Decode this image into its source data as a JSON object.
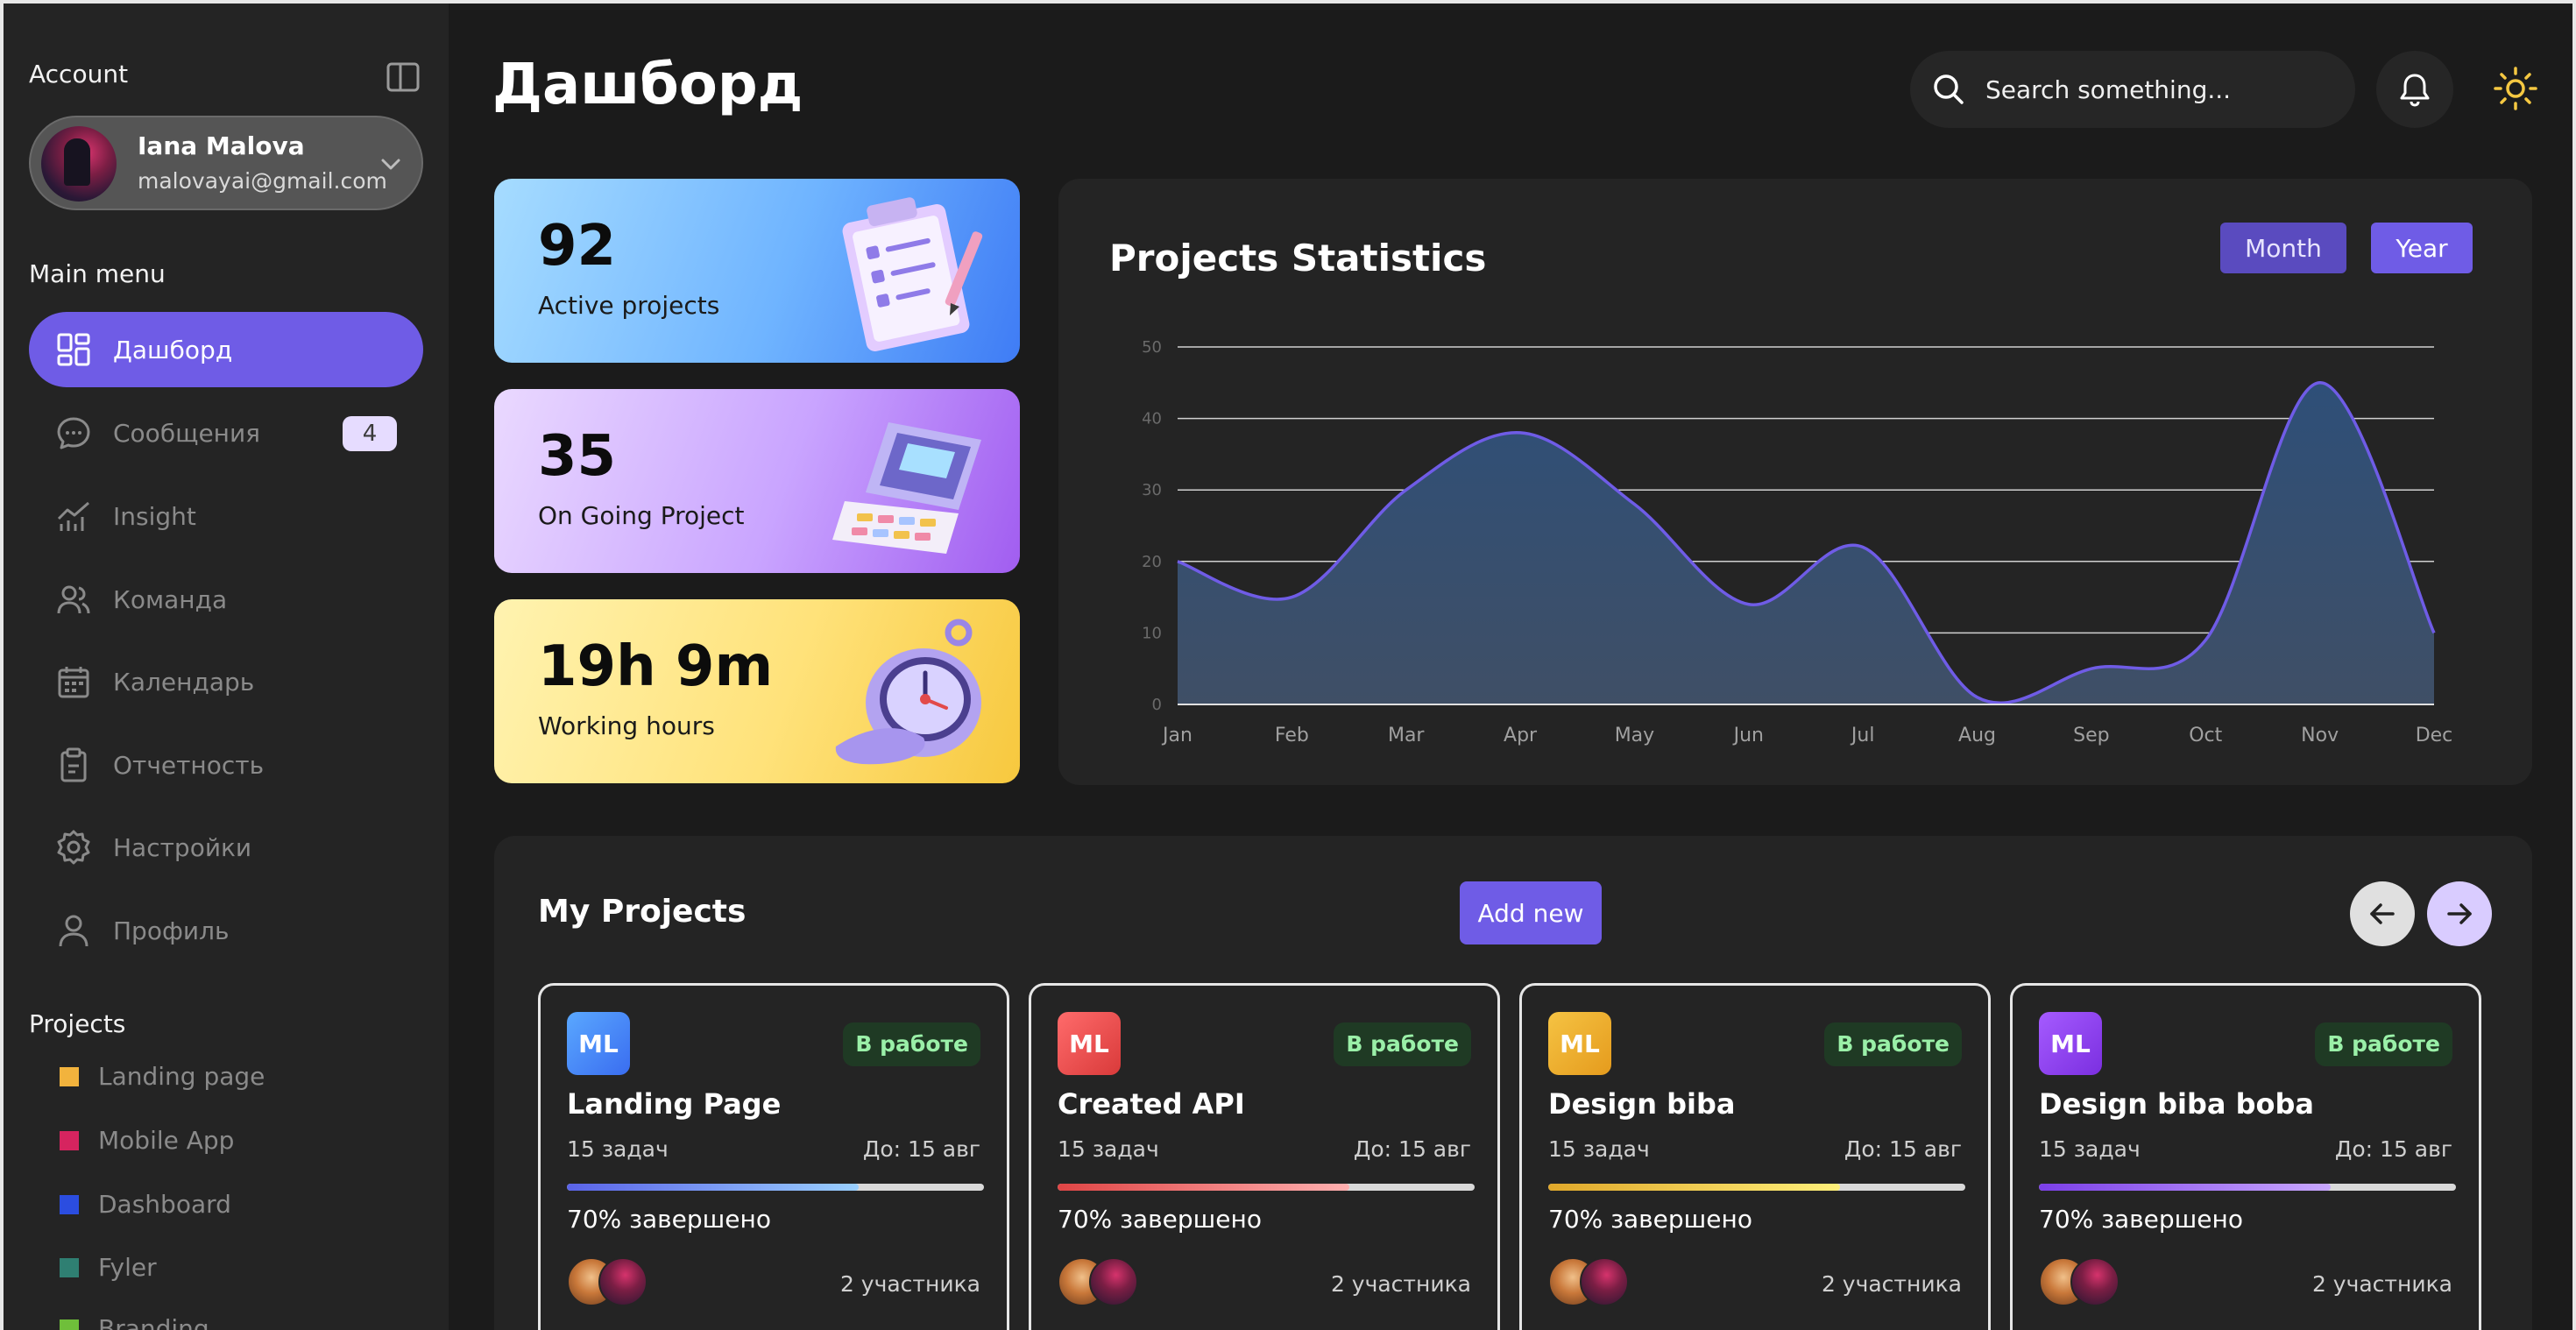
{
  "sidebar": {
    "account_heading": "Account",
    "user": {
      "name": "Iana Malova",
      "email": "malovayai@gmail.com"
    },
    "main_menu_heading": "Main menu",
    "menu": [
      {
        "label": "Дашборд",
        "icon": "dashboard-icon",
        "active": true
      },
      {
        "label": "Сообщения",
        "icon": "chat-icon",
        "badge": "4"
      },
      {
        "label": "Insight",
        "icon": "chart-line-icon"
      },
      {
        "label": "Команда",
        "icon": "users-icon"
      },
      {
        "label": "Календарь",
        "icon": "calendar-icon"
      },
      {
        "label": "Отчетность",
        "icon": "clipboard-icon"
      },
      {
        "label": "Настройки",
        "icon": "gear-icon"
      },
      {
        "label": "Профиль",
        "icon": "user-icon"
      }
    ],
    "projects_heading": "Projects",
    "projects": [
      {
        "label": "Landing page",
        "color": "#f2b33d"
      },
      {
        "label": "Mobile App",
        "color": "#d6245f"
      },
      {
        "label": "Dashboard",
        "color": "#2b4de0"
      },
      {
        "label": "Fyler",
        "color": "#2f7f72"
      },
      {
        "label": "Branding",
        "color": "#6fbf3a"
      }
    ]
  },
  "header": {
    "title": "Дашборд",
    "search_placeholder": "Search something..."
  },
  "stats": [
    {
      "value": "92",
      "label": "Active projects",
      "illustration": "clipboard-checklist-icon"
    },
    {
      "value": "35",
      "label": "On Going Project",
      "illustration": "calculator-icon"
    },
    {
      "value": "19h 9m",
      "label": "Working hours",
      "illustration": "stopwatch-icon"
    }
  ],
  "chart_data": {
    "type": "area",
    "title": "Projects Statistics",
    "toggle": [
      "Month",
      "Year"
    ],
    "categories": [
      "Jan",
      "Feb",
      "Mar",
      "Apr",
      "May",
      "Jun",
      "Jul",
      "Aug",
      "Sep",
      "Oct",
      "Nov",
      "Dec"
    ],
    "values": [
      20,
      15,
      30,
      38,
      28,
      14,
      22,
      1,
      5,
      9,
      45,
      10
    ],
    "ylim": [
      0,
      50
    ],
    "yticks": [
      "0",
      "10",
      "20",
      "30",
      "40",
      "50"
    ],
    "grid": true,
    "colors": {
      "line": "#6f5ce6",
      "fill_top": "#2e4f78",
      "fill_bottom": "#3f4f66"
    }
  },
  "projects_section": {
    "title": "My Projects",
    "add_label": "Add new",
    "cards": [
      {
        "initials": "ML",
        "status": "В работе",
        "title": "Landing Page",
        "tasks": "15 задач",
        "due": "До: 15 авг",
        "progress": 0.7,
        "progress_label": "70% завершено",
        "members": "2 участника",
        "logo_from": "#5aa8ff",
        "logo_to": "#3a6df0",
        "bar_from": "#5a63e8",
        "bar_to": "#9ad0ff"
      },
      {
        "initials": "ML",
        "status": "В работе",
        "title": "Created API",
        "tasks": "15 задач",
        "due": "До: 15 авг",
        "progress": 0.7,
        "progress_label": "70% завершено",
        "members": "2 участника",
        "logo_from": "#ff6b6b",
        "logo_to": "#d93a3a",
        "bar_from": "#e04545",
        "bar_to": "#ffb0b0"
      },
      {
        "initials": "ML",
        "status": "В работе",
        "title": "Design biba",
        "tasks": "15 задач",
        "due": "До: 15 авг",
        "progress": 0.7,
        "progress_label": "70% завершено",
        "members": "2 участника",
        "logo_from": "#f5c343",
        "logo_to": "#e59b1d",
        "bar_from": "#e0a82a",
        "bar_to": "#fff07a"
      },
      {
        "initials": "ML",
        "status": "В работе",
        "title": "Design biba boba",
        "tasks": "15 задач",
        "due": "До: 15 авг",
        "progress": 0.7,
        "progress_label": "70% завершено",
        "members": "2 участника",
        "logo_from": "#a55bff",
        "logo_to": "#7b2fe0",
        "bar_from": "#7b3fe8",
        "bar_to": "#c9a8ff"
      }
    ]
  }
}
